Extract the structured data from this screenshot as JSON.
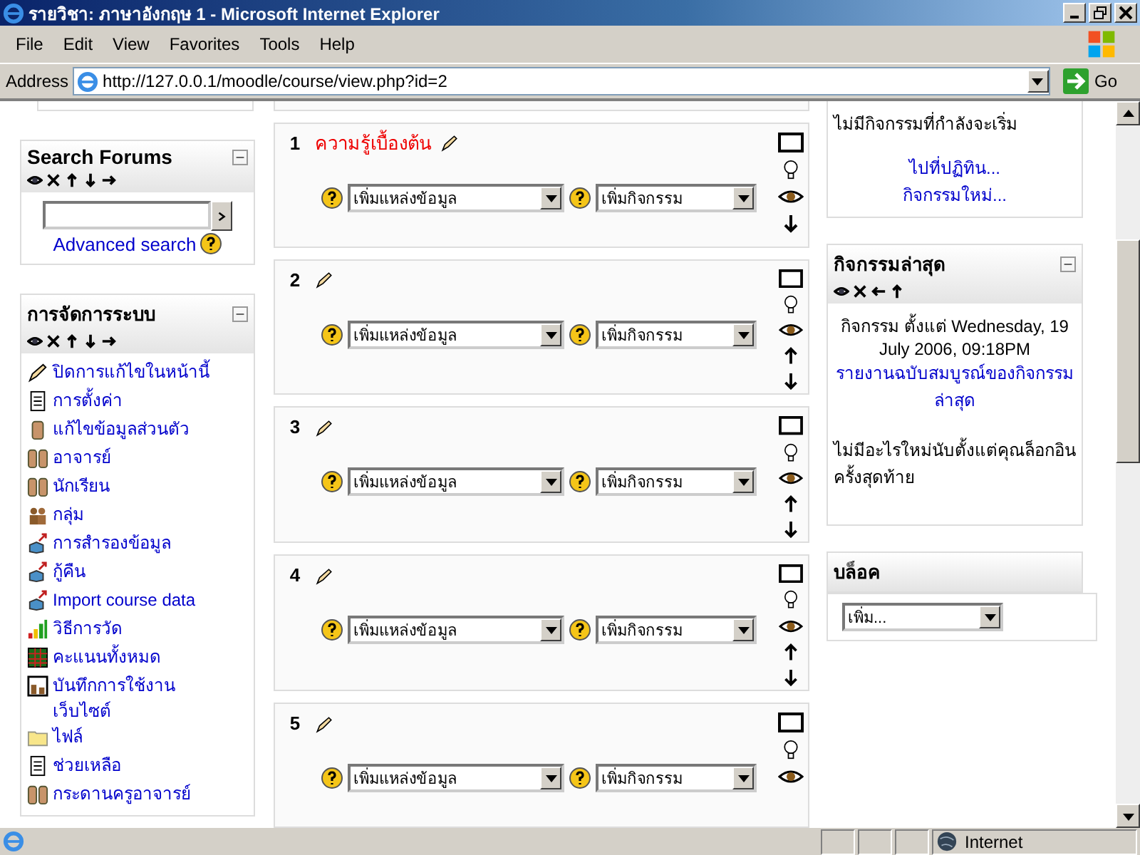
{
  "window": {
    "title": "รายวิชา: ภาษาอังกฤษ 1 - Microsoft Internet Explorer"
  },
  "menu": [
    "File",
    "Edit",
    "View",
    "Favorites",
    "Tools",
    "Help"
  ],
  "address_bar": {
    "label": "Address",
    "url": "http://127.0.0.1/moodle/course/view.php?id=2",
    "go": "Go"
  },
  "left_blocks": [
    {
      "kind": "search",
      "title": "Search Forums",
      "controls": [
        {
          "kind": "show"
        },
        {
          "kind": "delete"
        },
        {
          "kind": "up"
        },
        {
          "kind": "down"
        },
        {
          "kind": "right"
        }
      ],
      "link": "Advanced search"
    },
    {
      "kind": "menu",
      "title": "การจัดการระบบ",
      "controls": [
        {
          "kind": "show"
        },
        {
          "kind": "delete"
        },
        {
          "kind": "up"
        },
        {
          "kind": "down"
        },
        {
          "kind": "right"
        }
      ],
      "items": [
        {
          "kind": "edit",
          "label": "ปิดการแก้ไขในหน้านี้"
        },
        {
          "kind": "document",
          "label": "การตั้งค่า"
        },
        {
          "kind": "person",
          "label": "แก้ไขข้อมูลส่วนตัว"
        },
        {
          "kind": "people",
          "label": "อาจารย์"
        },
        {
          "kind": "people",
          "label": "นักเรียน"
        },
        {
          "kind": "group",
          "label": "กลุ่ม"
        },
        {
          "kind": "box",
          "label": "การสำรองข้อมูล"
        },
        {
          "kind": "box",
          "label": "กู้คืน"
        },
        {
          "kind": "box",
          "label": "Import course data"
        },
        {
          "kind": "chart",
          "label": "วิธีการวัด"
        },
        {
          "kind": "table",
          "label": "คะแนนทั้งหมด"
        },
        {
          "kind": "window",
          "label": "บันทึกการใช้งานเว็บไซต์"
        },
        {
          "kind": "folder",
          "label": "ไฟล์"
        },
        {
          "kind": "document",
          "label": "ช่วยเหลือ"
        },
        {
          "kind": "people",
          "label": "กระดานครูอาจารย์"
        }
      ]
    }
  ],
  "sections": [
    {
      "number": "1",
      "title": "ความรู้เบื้องต้น",
      "resource_select": "เพิ่มแหล่งข้อมูล",
      "activity_select": "เพิ่มกิจกรรม",
      "move_up": false,
      "move_down": true
    },
    {
      "number": "2",
      "resource_select": "เพิ่มแหล่งข้อมูล",
      "activity_select": "เพิ่มกิจกรรม",
      "move_up": true,
      "move_down": true
    },
    {
      "number": "3",
      "resource_select": "เพิ่มแหล่งข้อมูล",
      "activity_select": "เพิ่มกิจกรรม",
      "move_up": true,
      "move_down": true
    },
    {
      "number": "4",
      "resource_select": "เพิ่มแหล่งข้อมูล",
      "activity_select": "เพิ่มกิจกรรม",
      "move_up": true,
      "move_down": true
    },
    {
      "number": "5",
      "resource_select": "เพิ่มแหล่งข้อมูล",
      "activity_select": "เพิ่มกิจกรรม"
    }
  ],
  "right_blocks": [
    {
      "kind": "upcoming",
      "text": "ไม่มีกิจกรรมที่กำลังจะเริ่ม",
      "links": [
        "ไปที่ปฏิทิน...",
        "กิจกรรมใหม่..."
      ]
    },
    {
      "kind": "recent",
      "title": "กิจกรรมล่าสุด",
      "controls": [
        {
          "kind": "show"
        },
        {
          "kind": "delete"
        },
        {
          "kind": "left"
        },
        {
          "kind": "up"
        }
      ],
      "since": "กิจกรรม ตั้งแต่ Wednesday, 19 July 2006, 09:18PM",
      "link": "รายงานฉบับสมบูรณ์ของกิจกรรมล่าสุด",
      "note": "ไม่มีอะไรใหม่นับตั้งแต่คุณล็อกอินครั้งสุดท้าย"
    },
    {
      "kind": "add",
      "title": "บล็อค",
      "select": "เพิ่ม..."
    }
  ],
  "status_bar": {
    "zone": "Internet"
  }
}
